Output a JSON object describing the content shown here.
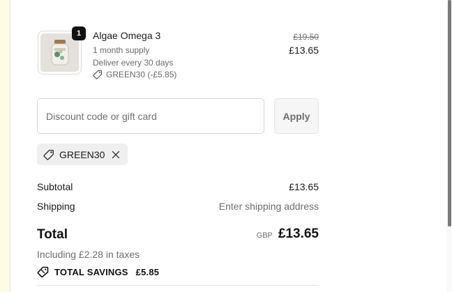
{
  "product": {
    "quantity": "1",
    "name": "Algae Omega 3",
    "supply": "1 month supply",
    "delivery": "Deliver every 30 days",
    "discount_applied": "GREEN30 (-£5.85)",
    "original_price": "£19.50",
    "price": "£13.65",
    "thumbnail_icon": "supplement-jar-image"
  },
  "discount": {
    "placeholder": "Discount code or gift card",
    "value": "",
    "apply_label": "Apply",
    "applied_code": "GREEN30"
  },
  "summary": {
    "subtotal_label": "Subtotal",
    "subtotal_value": "£13.65",
    "shipping_label": "Shipping",
    "shipping_value": "Enter shipping address",
    "total_label": "Total",
    "total_currency": "GBP",
    "total_value": "£13.65",
    "tax_note": "Including £2.28 in taxes",
    "savings_label": "TOTAL SAVINGS",
    "savings_value": "£5.85"
  },
  "colors": {
    "text": "#1a1a1a",
    "muted": "#6e6e6e",
    "badge": "#111111",
    "left_strip": "#fdfde6"
  }
}
